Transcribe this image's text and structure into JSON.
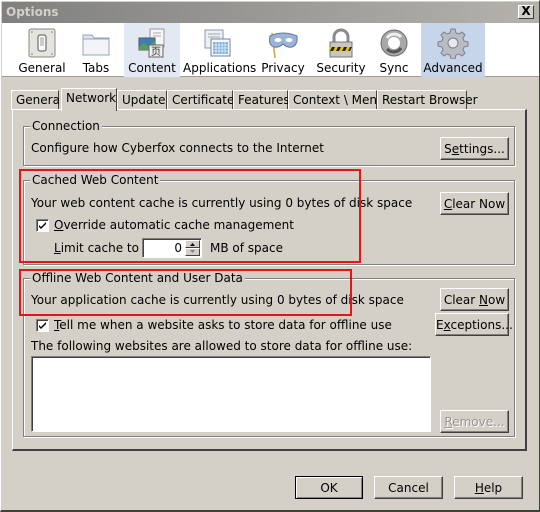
{
  "window": {
    "title": "Options",
    "close_glyph": "X"
  },
  "panes": [
    {
      "label": "General",
      "icon": "switch-icon"
    },
    {
      "label": "Tabs",
      "icon": "folder-tab-icon"
    },
    {
      "label": "Content",
      "icon": "content-page-icon",
      "state": "hover"
    },
    {
      "label": "Applications",
      "icon": "applications-icon"
    },
    {
      "label": "Privacy",
      "icon": "mask-icon"
    },
    {
      "label": "Security",
      "icon": "padlock-icon"
    },
    {
      "label": "Sync",
      "icon": "sync-icon"
    },
    {
      "label": "Advanced",
      "icon": "gear-icon",
      "state": "selected"
    }
  ],
  "tabs": [
    {
      "label": "General"
    },
    {
      "label": "Network",
      "active": true
    },
    {
      "label": "Update"
    },
    {
      "label": "Certificates"
    },
    {
      "label": "Features"
    },
    {
      "label": "Context \\ Menus"
    },
    {
      "label": "Restart Browser"
    }
  ],
  "connection": {
    "caption": "Connection",
    "description": "Configure how Cyberfox connects to the Internet",
    "settings_button": {
      "pre": "S",
      "accel": "e",
      "post": "ttings..."
    }
  },
  "cache": {
    "caption": "Cached Web Content",
    "usage_text": "Your web content cache is currently using 0 bytes of disk space",
    "clear_button": {
      "pre": "",
      "accel": "C",
      "post": "lear Now"
    },
    "override_checkbox": {
      "pre": "",
      "accel": "O",
      "post": "verride automatic cache management",
      "checked": true
    },
    "limit_label": {
      "pre": "",
      "accel": "L",
      "post": "imit cache to"
    },
    "limit_value": "0",
    "limit_unit": "MB of space"
  },
  "offline": {
    "caption": "Offline Web Content and User Data",
    "usage_text": "Your application cache is currently using 0 bytes of disk space",
    "clear_button": {
      "pre": "Clear ",
      "accel": "N",
      "post": "ow"
    },
    "exceptions_button": {
      "pre": "E",
      "accel": "x",
      "post": "ceptions..."
    },
    "tell_checkbox": {
      "pre": "",
      "accel": "T",
      "post": "ell me when a website asks to store data for offline use",
      "checked": true
    },
    "list_label": "The following websites are allowed to store data for offline use:",
    "list_items": [],
    "remove_button": {
      "pre": "",
      "accel": "R",
      "post": "emove...",
      "disabled": true
    }
  },
  "footer": {
    "ok": "OK",
    "cancel": "Cancel",
    "help": {
      "pre": "",
      "accel": "H",
      "post": "elp"
    }
  },
  "annotation_color": "#e0161b"
}
